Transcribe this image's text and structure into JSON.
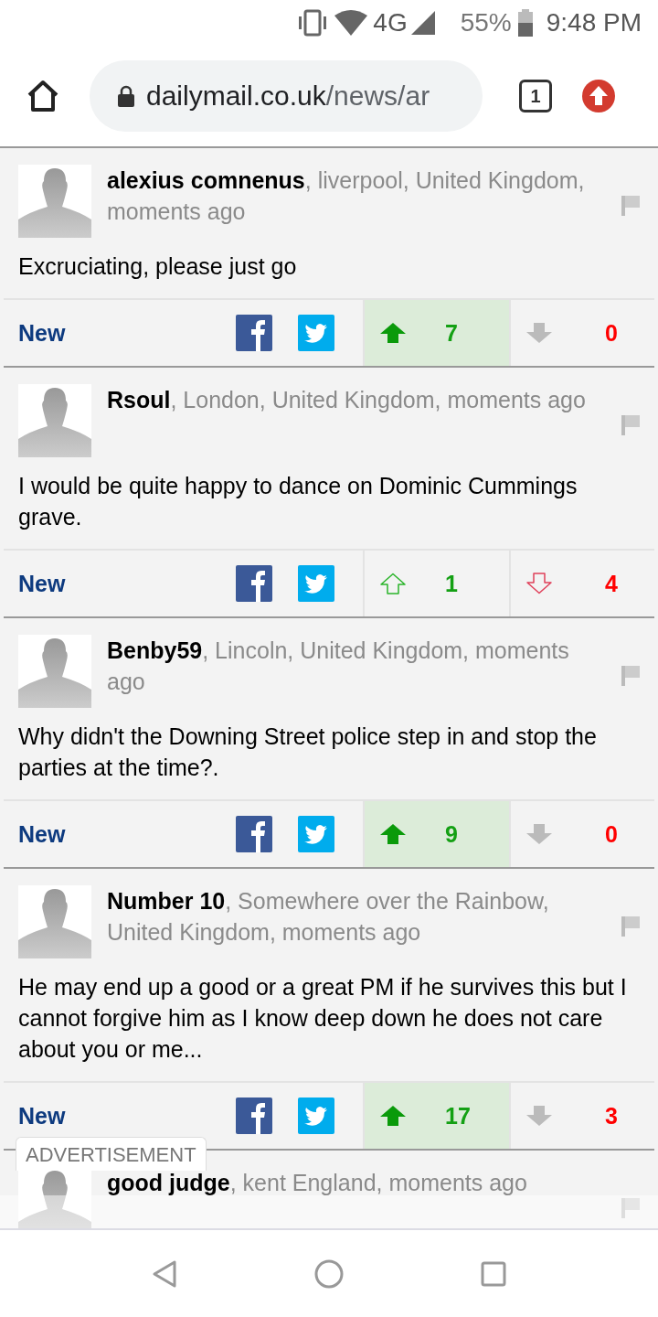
{
  "status_bar": {
    "network": "4G",
    "battery": "55%",
    "time": "9:48 PM"
  },
  "browser": {
    "url_host": "dailymail.co.uk",
    "url_path": "/news/ar",
    "tab_count": "1"
  },
  "comments": [
    {
      "username": "alexius comnenus",
      "meta": ", liverpool, United Kingdom, moments ago",
      "text": "Excruciating, please just go",
      "new_label": "New",
      "voted": true,
      "up_count": "7",
      "down_count": "0"
    },
    {
      "username": "Rsoul",
      "meta": ", London, United Kingdom, moments ago",
      "text": "I would be quite happy to dance on Dominic Cummings grave.",
      "new_label": "New",
      "voted": false,
      "up_count": "1",
      "down_count": "4"
    },
    {
      "username": "Benby59",
      "meta": ", Lincoln, United Kingdom, moments ago",
      "text": "Why didn't the Downing Street police step in and stop the parties at the time?.",
      "new_label": "New",
      "voted": true,
      "up_count": "9",
      "down_count": "0"
    },
    {
      "username": "Number 10",
      "meta": ", Somewhere over the Rainbow, United Kingdom, moments ago",
      "text": "He may end up a good or a great PM if he survives this but I cannot forgive him as I know deep down he does not care about you or me...",
      "new_label": "New",
      "voted": true,
      "up_count": "17",
      "down_count": "3"
    },
    {
      "username": "good judge",
      "meta": ", kent England, moments ago"
    }
  ],
  "ad": {
    "label": "ADVERTISEMENT"
  }
}
